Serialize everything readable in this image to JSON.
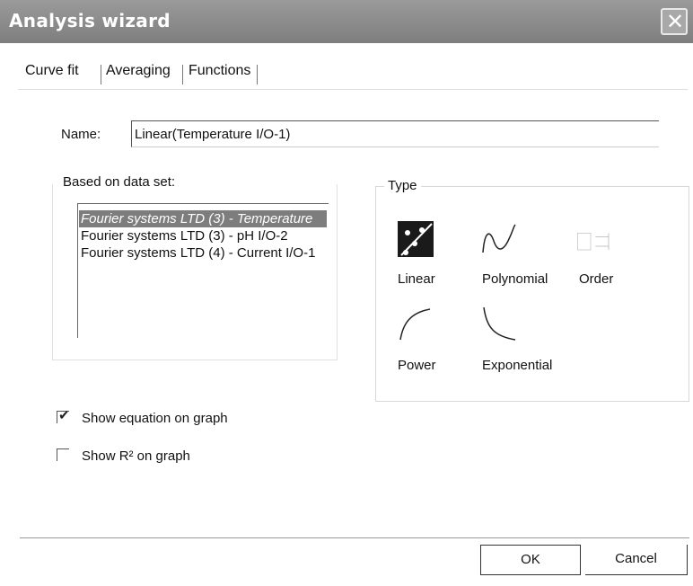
{
  "window": {
    "title": "Analysis wizard",
    "close_label": "✕"
  },
  "tabs": [
    {
      "label": "Curve fit",
      "selected": true
    },
    {
      "label": "Averaging",
      "selected": false
    },
    {
      "label": "Functions",
      "selected": false
    }
  ],
  "name_field": {
    "label": "Name:",
    "value": "Linear(Temperature I/O-1)"
  },
  "data_set": {
    "label": "Based on data set:",
    "items": [
      {
        "label": "Fourier systems LTD (3) - Temperature",
        "selected": true
      },
      {
        "label": "Fourier systems LTD (3) - pH I/O-2",
        "selected": false
      },
      {
        "label": "Fourier systems LTD (4) - Current I/O-1",
        "selected": false
      }
    ]
  },
  "type": {
    "label": "Type",
    "options": [
      {
        "label": "Linear",
        "icon": "linear-icon",
        "selected": true
      },
      {
        "label": "Polynomial",
        "icon": "polynomial-icon",
        "selected": false
      },
      {
        "label": "Order",
        "icon": "order-icon",
        "selected": false
      },
      {
        "label": "Power",
        "icon": "power-icon",
        "selected": false
      },
      {
        "label": "Exponential",
        "icon": "exponential-icon",
        "selected": false
      }
    ]
  },
  "options": {
    "show_equation": {
      "label": "Show equation on graph",
      "checked": true
    },
    "show_r2": {
      "label": "Show R² on graph",
      "checked": false
    }
  },
  "buttons": {
    "ok": "OK",
    "cancel": "Cancel"
  }
}
